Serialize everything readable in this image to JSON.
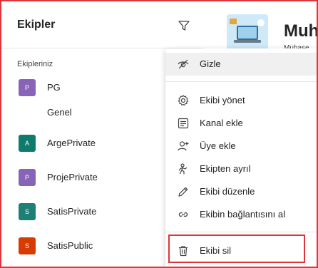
{
  "sidebar": {
    "title": "Ekipler",
    "filter_icon": "filter-icon",
    "section_label": "Ekipleriniz",
    "teams": [
      {
        "name": "PG",
        "initial": "P",
        "color": "#8764b8"
      },
      {
        "name": "ArgePrivate",
        "initial": "A",
        "color": "#0f7b6c"
      },
      {
        "name": "ProjePrivate",
        "initial": "P",
        "color": "#8764b8"
      },
      {
        "name": "SatisPrivate",
        "initial": "S",
        "color": "#1e7f74"
      },
      {
        "name": "SatisPublic",
        "initial": "S",
        "color": "#d83b01"
      }
    ],
    "channel": "Genel"
  },
  "main": {
    "title": "Muh",
    "subtitle": "Muhase"
  },
  "context_menu": {
    "items": [
      {
        "label": "Gizle",
        "icon": "hide-icon"
      },
      {
        "label": "Ekibi yönet",
        "icon": "gear-icon"
      },
      {
        "label": "Kanal ekle",
        "icon": "channel-list-icon"
      },
      {
        "label": "Üye ekle",
        "icon": "add-member-icon"
      },
      {
        "label": "Ekipten ayrıl",
        "icon": "leave-team-icon"
      },
      {
        "label": "Ekibi düzenle",
        "icon": "pencil-icon"
      },
      {
        "label": "Ekibin bağlantısını al",
        "icon": "link-icon"
      },
      {
        "label": "Ekibi sil",
        "icon": "trash-icon"
      }
    ]
  },
  "colors": {
    "highlight_border": "#e0343b",
    "menu_hover": "#f0f0f0"
  }
}
